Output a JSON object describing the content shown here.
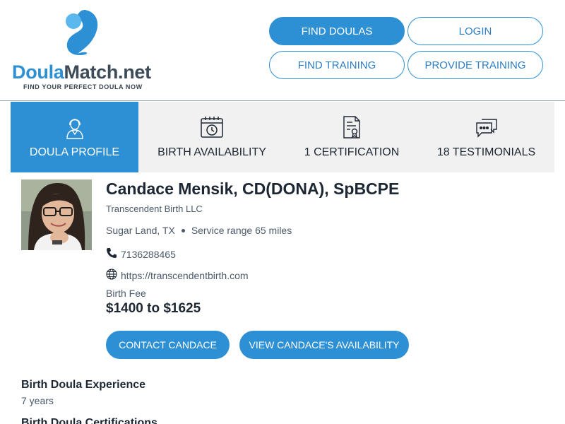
{
  "brand": {
    "name_part1": "Doula",
    "name_part2": "Match.net",
    "tagline": "FIND YOUR PERFECT DOULA NOW",
    "primary_color": "#2d8fd4",
    "light_color": "#5bb8ee"
  },
  "nav": {
    "find_doulas": "FIND DOULAS",
    "login": "LOGIN",
    "find_training": "FIND TRAINING",
    "provide_training": "PROVIDE TRAINING"
  },
  "tabs": [
    {
      "label": "DOULA PROFILE",
      "icon": "doula-icon",
      "active": true
    },
    {
      "label": "BIRTH AVAILABILITY",
      "icon": "calendar-clock-icon",
      "active": false
    },
    {
      "label": "1 CERTIFICATION",
      "icon": "certificate-icon",
      "active": false
    },
    {
      "label": "18 TESTIMONIALS",
      "icon": "chat-bubbles-icon",
      "active": false
    }
  ],
  "profile": {
    "name": "Candace Mensik, CD(DONA), SpBCPE",
    "company": "Transcendent Birth LLC",
    "location": "Sugar Land, TX",
    "service_range": "Service range 65 miles",
    "phone": "7136288465",
    "website": "https://transcendentbirth.com",
    "fee_label": "Birth Fee",
    "fee_value": "$1400 to $1625",
    "contact_button": "CONTACT CANDACE",
    "availability_button": "VIEW CANDACE'S AVAILABILITY"
  },
  "experience": {
    "title": "Birth Doula Experience",
    "value": "7 years"
  },
  "certification": {
    "title": "Birth Doula Certifications"
  }
}
